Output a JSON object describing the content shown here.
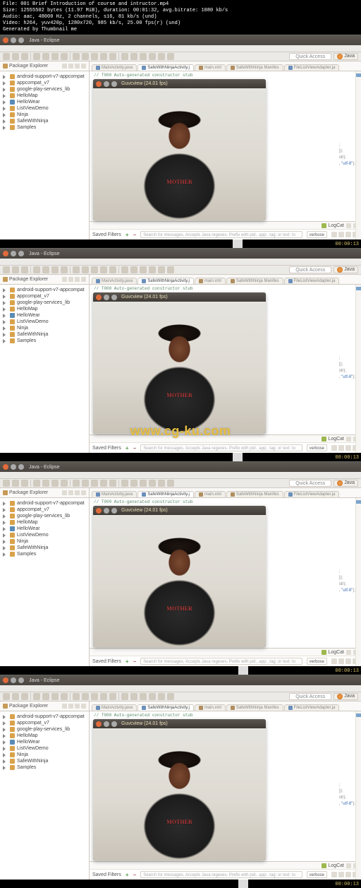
{
  "file_info": "File: 001 Brief Introduction of course and intructor.mp4\nSize: 12555502 bytes (11.97 MiB), duration: 00:01:32, avg.bitrate: 1080 kb/s\nAudio: aac, 48000 Hz, 2 channels, s16, 81 kb/s (und)\nVideo: h264, yuv420p, 1280x720, 985 kb/s, 25.00 fps(r) (und)\nGenerated by Thumbnail me",
  "window_title": "Java - Eclipse",
  "quick_access": "Quick Access",
  "perspective": "Java",
  "package_explorer": "Package Explorer",
  "projects": [
    {
      "name": "android-support-v7-appcompat",
      "icon": "orange"
    },
    {
      "name": "appcompat_v7",
      "icon": "orange"
    },
    {
      "name": "google-play-services_lib",
      "icon": "orange"
    },
    {
      "name": "HelloMap",
      "icon": "orange"
    },
    {
      "name": "HelloWear",
      "icon": "blue"
    },
    {
      "name": "ListViewDemo",
      "icon": "orange"
    },
    {
      "name": "Ninja",
      "icon": "orange"
    },
    {
      "name": "SafeWithNinja",
      "icon": "orange"
    },
    {
      "name": "Samples",
      "icon": "orange"
    }
  ],
  "editor_tabs": [
    {
      "label": "MainActivity.java",
      "icon": "j",
      "active": false
    },
    {
      "label": "SafeWithNinjaActivity.j",
      "icon": "j",
      "active": true
    },
    {
      "label": "main.xml",
      "icon": "x",
      "active": false
    },
    {
      "label": "SafeWithNinja Manifes",
      "icon": "x",
      "active": false
    },
    {
      "label": "FileListViewAdapter.ja",
      "icon": "j",
      "active": false
    }
  ],
  "code_comment": "// T000 Auto-generated constructor stub",
  "video_title": "Guvcview  (24.01 fps)",
  "shirt_text": "MOTHER",
  "right_snips": [
    ";",
    "});",
    "str);",
    ", \"utf-8\");"
  ],
  "logcat": "LogCat",
  "saved_filters": "Saved Filters",
  "search_placeholder": "Search for messages. Accepts Java regexes. Prefix with pid:, app:, tag: or text: to lim",
  "verbose": "verbose",
  "watermark": "www.cg-ku.com",
  "timestamps": [
    "00:00:13",
    "00:00:13",
    "00:00:13",
    "00:00:13"
  ],
  "cursor_positions": [
    "64.5%",
    "64.5%",
    "66%",
    "66%"
  ]
}
